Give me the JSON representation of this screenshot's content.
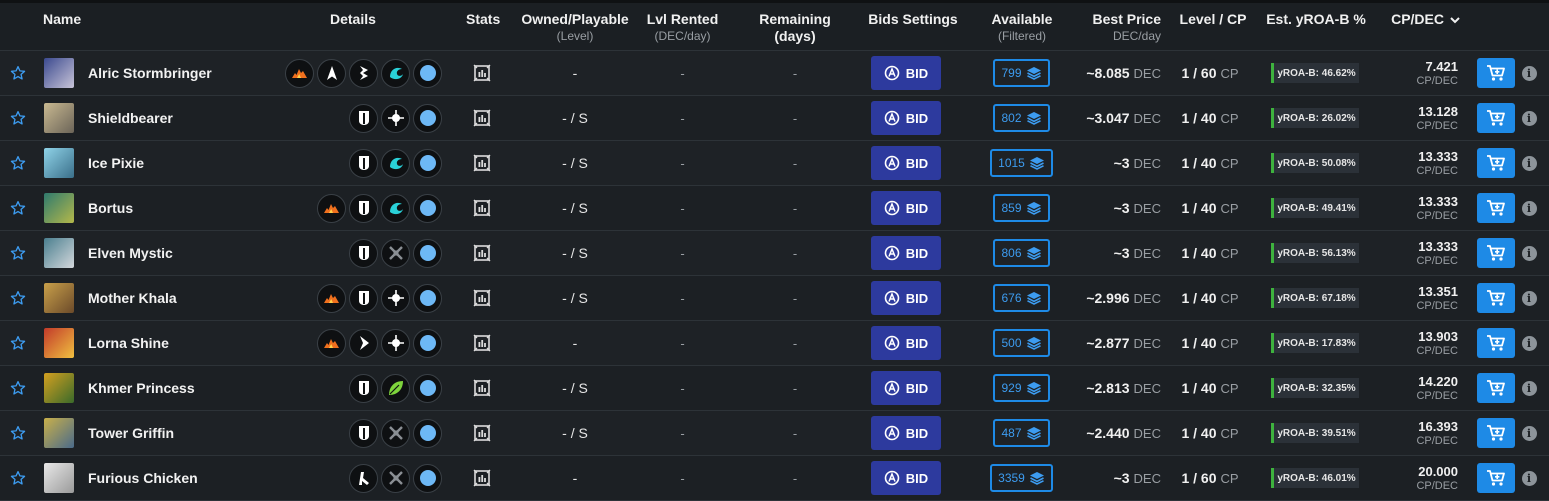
{
  "headers": {
    "name": "Name",
    "details": "Details",
    "stats": "Stats",
    "owned": "Owned/Playable",
    "owned_sub": "(Level)",
    "lvl_rented": "Lvl Rented",
    "lvl_rented_sub": "(DEC/day)",
    "remaining": "Remaining (days)",
    "bids": "Bids Settings",
    "available": "Available",
    "available_sub": "(Filtered)",
    "best_price": "Best Price",
    "best_price_sub": "DEC/day",
    "level_cp": "Level / CP",
    "yroa": "Est. yROA-B %",
    "cpdec": "CP/DEC",
    "sort_icon": "chevron-down-icon"
  },
  "colors": {
    "background": "#1b1f23",
    "bid_button": "#2d3a9e",
    "accent_blue": "#1e8ae6",
    "yroa_green": "#3eb23e"
  },
  "labels": {
    "bid": "BID",
    "cp_unit": "CP",
    "dec_unit": "DEC",
    "cpdec_unit": "CP/DEC",
    "dash": "-"
  },
  "rows": [
    {
      "name": "Alric Stormbringer",
      "avatar": [
        "#3b4a8f",
        "#c8c4d8"
      ],
      "abilities": [
        "fire",
        "arrow",
        "lightning",
        "water",
        "orb"
      ],
      "owned": "-",
      "lvl_rented": "-",
      "remaining": "-",
      "available": "799",
      "price": "~8.085",
      "level": "1 / 60",
      "yroa": "yROA-B: 46.62%",
      "cpdec": "7.421"
    },
    {
      "name": "Shieldbearer",
      "avatar": [
        "#c9b991",
        "#6b6458"
      ],
      "abilities": [
        "shield",
        "target",
        "orb"
      ],
      "owned": "- / S",
      "lvl_rented": "-",
      "remaining": "-",
      "available": "802",
      "price": "~3.047",
      "level": "1 / 40",
      "yroa": "yROA-B: 26.02%",
      "cpdec": "13.128"
    },
    {
      "name": "Ice Pixie",
      "avatar": [
        "#8fd3e8",
        "#3a6f8a"
      ],
      "abilities": [
        "shield",
        "water",
        "orb"
      ],
      "owned": "- / S",
      "lvl_rented": "-",
      "remaining": "-",
      "available": "1015",
      "price": "~3",
      "level": "1 / 40",
      "yroa": "yROA-B: 50.08%",
      "cpdec": "13.333"
    },
    {
      "name": "Bortus",
      "avatar": [
        "#2f7a6e",
        "#b4b84a"
      ],
      "abilities": [
        "fire",
        "shield",
        "water",
        "orb"
      ],
      "owned": "- / S",
      "lvl_rented": "-",
      "remaining": "-",
      "available": "859",
      "price": "~3",
      "level": "1 / 40",
      "yroa": "yROA-B: 49.41%",
      "cpdec": "13.333"
    },
    {
      "name": "Elven Mystic",
      "avatar": [
        "#4a7f8f",
        "#d4d8dc"
      ],
      "abilities": [
        "shield",
        "crossed",
        "orb"
      ],
      "owned": "- / S",
      "lvl_rented": "-",
      "remaining": "-",
      "available": "806",
      "price": "~3",
      "level": "1 / 40",
      "yroa": "yROA-B: 56.13%",
      "cpdec": "13.333"
    },
    {
      "name": "Mother Khala",
      "avatar": [
        "#c9a04a",
        "#6b4a2a"
      ],
      "abilities": [
        "fire",
        "shield",
        "target",
        "orb"
      ],
      "owned": "- / S",
      "lvl_rented": "-",
      "remaining": "-",
      "available": "676",
      "price": "~2.996",
      "level": "1 / 40",
      "yroa": "yROA-B: 67.18%",
      "cpdec": "13.351"
    },
    {
      "name": "Lorna Shine",
      "avatar": [
        "#c23a2a",
        "#f0c040"
      ],
      "abilities": [
        "fire",
        "chevron",
        "target",
        "orb"
      ],
      "owned": "-",
      "lvl_rented": "-",
      "remaining": "-",
      "available": "500",
      "price": "~2.877",
      "level": "1 / 40",
      "yroa": "yROA-B: 17.83%",
      "cpdec": "13.903"
    },
    {
      "name": "Khmer Princess",
      "avatar": [
        "#d4a020",
        "#3a6a2a"
      ],
      "abilities": [
        "shield",
        "leaf",
        "orb"
      ],
      "owned": "- / S",
      "lvl_rented": "-",
      "remaining": "-",
      "available": "929",
      "price": "~2.813",
      "level": "1 / 40",
      "yroa": "yROA-B: 32.35%",
      "cpdec": "14.220"
    },
    {
      "name": "Tower Griffin",
      "avatar": [
        "#c9b04a",
        "#4a6a8a"
      ],
      "abilities": [
        "shield",
        "crossed",
        "orb"
      ],
      "owned": "- / S",
      "lvl_rented": "-",
      "remaining": "-",
      "available": "487",
      "price": "~2.440",
      "level": "1 / 40",
      "yroa": "yROA-B: 39.51%",
      "cpdec": "16.393"
    },
    {
      "name": "Furious Chicken",
      "avatar": [
        "#e8e8e8",
        "#9a9a9a"
      ],
      "abilities": [
        "kick",
        "crossed",
        "orb"
      ],
      "owned": "-",
      "lvl_rented": "-",
      "remaining": "-",
      "available": "3359",
      "price": "~3",
      "level": "1 / 60",
      "yroa": "yROA-B: 46.01%",
      "cpdec": "20.000"
    }
  ]
}
